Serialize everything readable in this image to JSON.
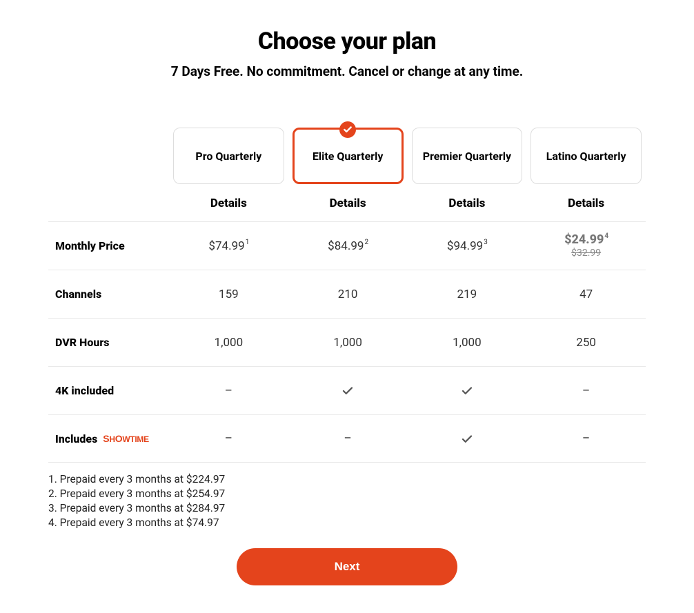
{
  "heading": "Choose your plan",
  "subheading": "7 Days Free. No commitment. Cancel or change at any time.",
  "details_label": "Details",
  "plans": [
    {
      "name": "Pro Quarterly",
      "selected": false
    },
    {
      "name": "Elite Quarterly",
      "selected": true
    },
    {
      "name": "Premier Quarterly",
      "selected": false
    },
    {
      "name": "Latino Quarterly",
      "selected": false
    }
  ],
  "rows": {
    "monthly_price": {
      "label": "Monthly Price",
      "values": [
        {
          "price": "$74.99",
          "footnote": "1"
        },
        {
          "price": "$84.99",
          "footnote": "2"
        },
        {
          "price": "$94.99",
          "footnote": "3"
        },
        {
          "price": "$24.99",
          "footnote": "4",
          "was": "$32.99",
          "discount": true
        }
      ]
    },
    "channels": {
      "label": "Channels",
      "values": [
        "159",
        "210",
        "219",
        "47"
      ]
    },
    "dvr": {
      "label": "DVR Hours",
      "values": [
        "1,000",
        "1,000",
        "1,000",
        "250"
      ]
    },
    "fourk": {
      "label": "4K included",
      "values": [
        "dash",
        "check",
        "check",
        "dash"
      ]
    },
    "showtime": {
      "label": "Includes",
      "brand": "SHOWTIME",
      "values": [
        "dash",
        "dash",
        "check",
        "dash"
      ]
    }
  },
  "footnotes": [
    "1. Prepaid every 3 months at $224.97",
    "2. Prepaid every 3 months at $254.97",
    "3. Prepaid every 3 months at $284.97",
    "4. Prepaid every 3 months at $74.97"
  ],
  "next_label": "Next"
}
